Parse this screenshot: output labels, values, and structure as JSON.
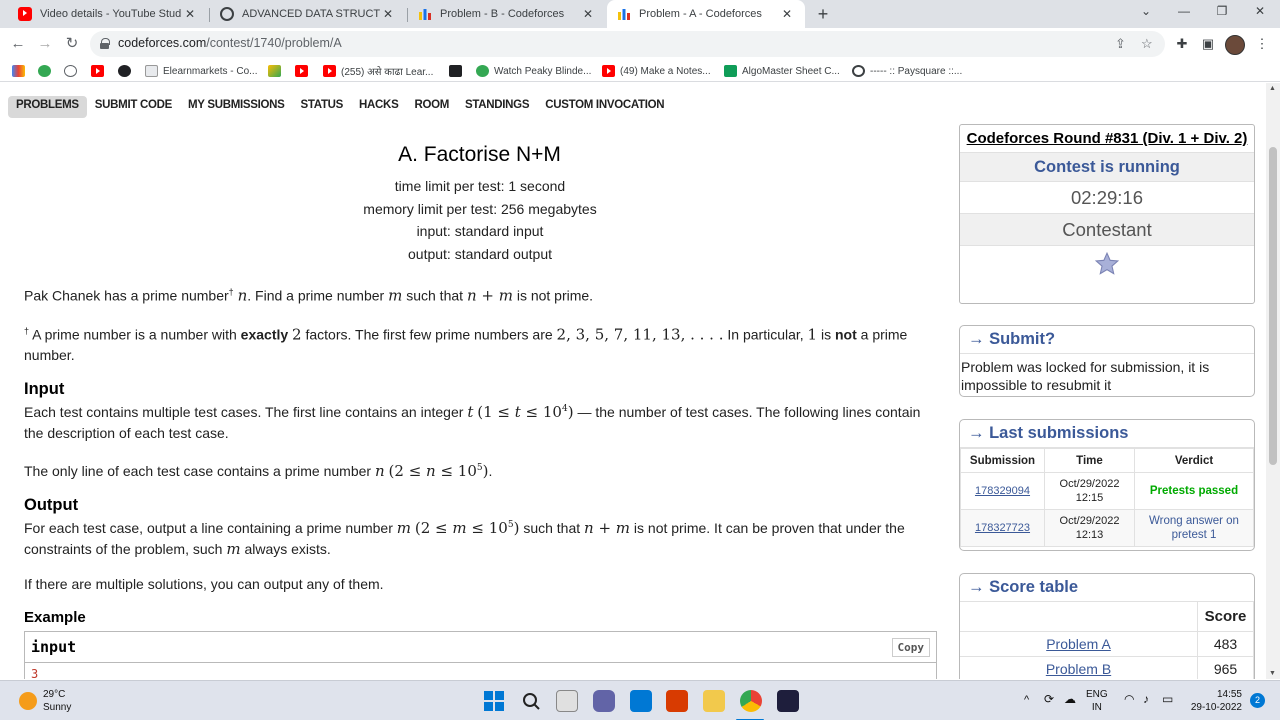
{
  "browser": {
    "tabs": [
      {
        "title": "Video details - YouTube Studio",
        "icon": "youtube-icon"
      },
      {
        "title": "ADVANCED DATA STRUCTURES |",
        "icon": "globe-icon"
      },
      {
        "title": "Problem - B - Codeforces",
        "icon": "codeforces-icon"
      },
      {
        "title": "Problem - A - Codeforces",
        "icon": "codeforces-icon",
        "active": true
      }
    ],
    "url_host": "codeforces.com",
    "url_path": "/contest/1740/problem/A",
    "bookmarks": [
      {
        "label": "",
        "icon": "gmail-icon"
      },
      {
        "label": "",
        "icon": "green-badge-icon"
      },
      {
        "label": "",
        "icon": "settings-globe-icon"
      },
      {
        "label": "",
        "icon": "youtube-icon"
      },
      {
        "label": "",
        "icon": "github-icon"
      },
      {
        "label": "Elearnmarkets - Co...",
        "icon": "elearn-icon"
      },
      {
        "label": "",
        "icon": "pencil-icon"
      },
      {
        "label": "",
        "icon": "youtube-icon"
      },
      {
        "label": "(255) असे काढा Lear...",
        "icon": "youtube-icon"
      },
      {
        "label": "",
        "icon": "terminal-icon"
      },
      {
        "label": "Watch Peaky Blinde...",
        "icon": "play-icon"
      },
      {
        "label": "(49) Make a Notes...",
        "icon": "youtube-icon"
      },
      {
        "label": "AlgoMaster Sheet C...",
        "icon": "sheets-icon"
      },
      {
        "label": "----- :: Paysquare ::...",
        "icon": "globe-icon"
      }
    ]
  },
  "cf_menu": [
    "PROBLEMS",
    "SUBMIT CODE",
    "MY SUBMISSIONS",
    "STATUS",
    "HACKS",
    "ROOM",
    "STANDINGS",
    "CUSTOM INVOCATION"
  ],
  "problem": {
    "title": "A. Factorise N+M",
    "time_limit": "time limit per test: 1 second",
    "memory_limit": "memory limit per test: 256 megabytes",
    "input": "input: standard input",
    "output": "output: standard output",
    "statement_1a": "Pak Chanek has a prime number",
    "statement_1b": ". Find a prime number",
    "statement_1c": "such that",
    "statement_1d": "is not prime.",
    "footnote_a": "A prime number is a number with",
    "footnote_bold": "exactly",
    "footnote_b": "factors. The first few prime numbers are",
    "footnote_primes": "2, 3, 5, 7, 11, 13, . . . .",
    "footnote_c": "In particular,",
    "footnote_one": "1",
    "footnote_d": "is",
    "footnote_not": "not",
    "footnote_e": "a prime number.",
    "input_title": "Input",
    "input_text_a": "Each test contains multiple test cases. The first line contains an integer",
    "input_text_b": "— the number of test cases. The following lines contain the description of each test case.",
    "input_line2": "The only line of each test case contains a prime number",
    "output_title": "Output",
    "output_text_a": "For each test case, output a line containing a prime number",
    "output_text_b": "such that",
    "output_text_c": "is not prime. It can be proven that under the constraints of the problem, such",
    "output_text_d": "always exists.",
    "multi_solutions": "If there are multiple solutions, you can output any of them.",
    "example_title": "Example",
    "example_input_label": "input",
    "copy_label": "Copy",
    "example_first_line": "3"
  },
  "sidebar": {
    "contest_name": "Codeforces Round #831 (Div. 1 + Div. 2)",
    "contest_status": "Contest is running",
    "timer": "02:29:16",
    "role": "Contestant",
    "submit_title": "→ Submit?",
    "submit_locked": "Problem was locked for submission, it is impossible to resubmit it",
    "last_sub_title": "→ Last submissions",
    "last_sub_headers": [
      "Submission",
      "Time",
      "Verdict"
    ],
    "submissions": [
      {
        "id": "178329094",
        "date": "Oct/29/2022",
        "time": "12:15",
        "verdict": "Pretests passed"
      },
      {
        "id": "178327723",
        "date": "Oct/29/2022",
        "time": "12:13",
        "verdict": "Wrong answer on pretest 1"
      }
    ],
    "score_title": "→ Score table",
    "score_header": "Score",
    "scores": [
      {
        "problem": "Problem A",
        "score": "483"
      },
      {
        "problem": "Problem B",
        "score": "965"
      }
    ]
  },
  "taskbar": {
    "weather_temp": "29°C",
    "weather_desc": "Sunny",
    "lang": "ENG",
    "region": "IN",
    "time": "14:55",
    "date": "29-10-2022",
    "notif_count": "2"
  }
}
